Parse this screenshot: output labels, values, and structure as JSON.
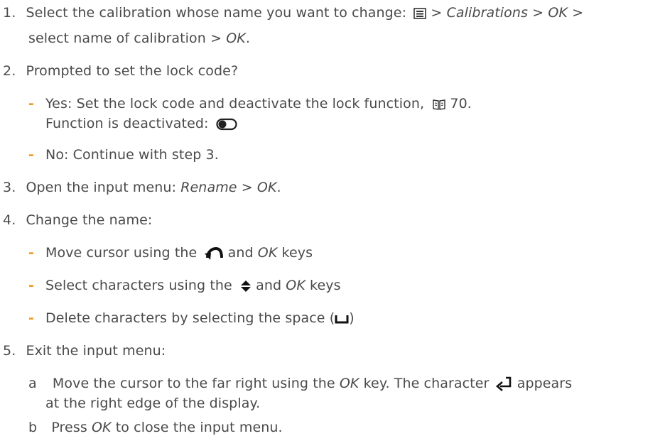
{
  "steps": {
    "s1": {
      "num": "1.",
      "a": "Select the calibration whose name you want to change:",
      "menu_icon": "menu-icon",
      "b": " > ",
      "i1": "Calibrations",
      "c": " > ",
      "i2": "OK",
      "d": " >",
      "line2a": "select name of calibration > ",
      "line2i": "OK",
      "line2b": "."
    },
    "s2": {
      "num": "2.",
      "text": "Prompted to set the lock code?",
      "yes_a": "Yes: Set the lock code and deactivate the lock function,",
      "book_icon": "manual-book-icon",
      "yes_ref": " 70.",
      "yes_line2": "Function is deactivated:",
      "toggle_icon": "toggle-off-icon",
      "no": "No: Continue with step 3."
    },
    "s3": {
      "num": "3.",
      "a": "Open the input menu: ",
      "i1": "Rename",
      "b": " > ",
      "i2": "OK",
      "c": "."
    },
    "s4": {
      "num": "4.",
      "text": "Change the name:",
      "b1a": "Move cursor using the",
      "b1icon": "back-arrow-icon",
      "b1b": " and ",
      "b1i": "OK",
      "b1c": " keys",
      "b2a": "Select characters using the",
      "b2icon": "up-down-arrows-icon",
      "b2b": " and ",
      "b2i": "OK",
      "b2c": " keys",
      "b3a": "Delete characters by selecting the space (",
      "b3icon": "space-icon",
      "b3b": ")"
    },
    "s5": {
      "num": "5.",
      "text": "Exit the input menu:",
      "a_label": "a",
      "a1": "Move the cursor to the far right using the ",
      "a1i": "OK",
      "a1b": " key. The character",
      "a1icon": "enter-icon",
      "a1c": "appears",
      "a2": "at the right edge of the display.",
      "b_label": "b",
      "b1": "Press ",
      "b1i": "OK",
      "b1b": " to close the input menu."
    },
    "dash": "-"
  },
  "colors": {
    "text": "#4a4a4a",
    "accent": "#f29a1f"
  }
}
